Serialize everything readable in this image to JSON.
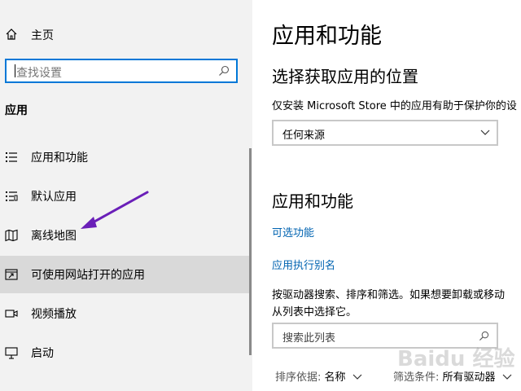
{
  "sidebar": {
    "home_label": "主页",
    "search_placeholder": "查找设置",
    "section_title": "应用",
    "items": [
      {
        "label": "应用和功能",
        "icon": "apps-features-icon"
      },
      {
        "label": "默认应用",
        "icon": "default-apps-icon"
      },
      {
        "label": "离线地图",
        "icon": "offline-maps-icon"
      },
      {
        "label": "可使用网站打开的应用",
        "icon": "apps-for-websites-icon",
        "selected": true
      },
      {
        "label": "视频播放",
        "icon": "video-playback-icon"
      },
      {
        "label": "启动",
        "icon": "startup-icon"
      }
    ]
  },
  "main": {
    "title": "应用和功能",
    "choose_heading": "选择获取应用的位置",
    "choose_desc": "仅安装 Microsoft Store 中的应用有助于保护你的设",
    "source_dropdown_value": "任何来源",
    "apps_heading": "应用和功能",
    "optional_features_link": "可选功能",
    "app_alias_link": "应用执行别名",
    "search_desc_line1": "按驱动器搜索、排序和筛选。如果想要卸载或移动",
    "search_desc_line2": "从列表中选择它。",
    "list_search_placeholder": "搜索此列表",
    "sort_label": "排序依据:",
    "sort_value": "名称",
    "filter_label": "筛选条件:",
    "filter_value": "所有驱动器"
  },
  "watermark": "Baidu 经验",
  "colors": {
    "accent": "#0078d7",
    "link": "#0063b1",
    "sidebar_bg": "#f2f2f2",
    "selected_bg": "#d9d9d9",
    "annotation_arrow": "#6a1fb8"
  }
}
